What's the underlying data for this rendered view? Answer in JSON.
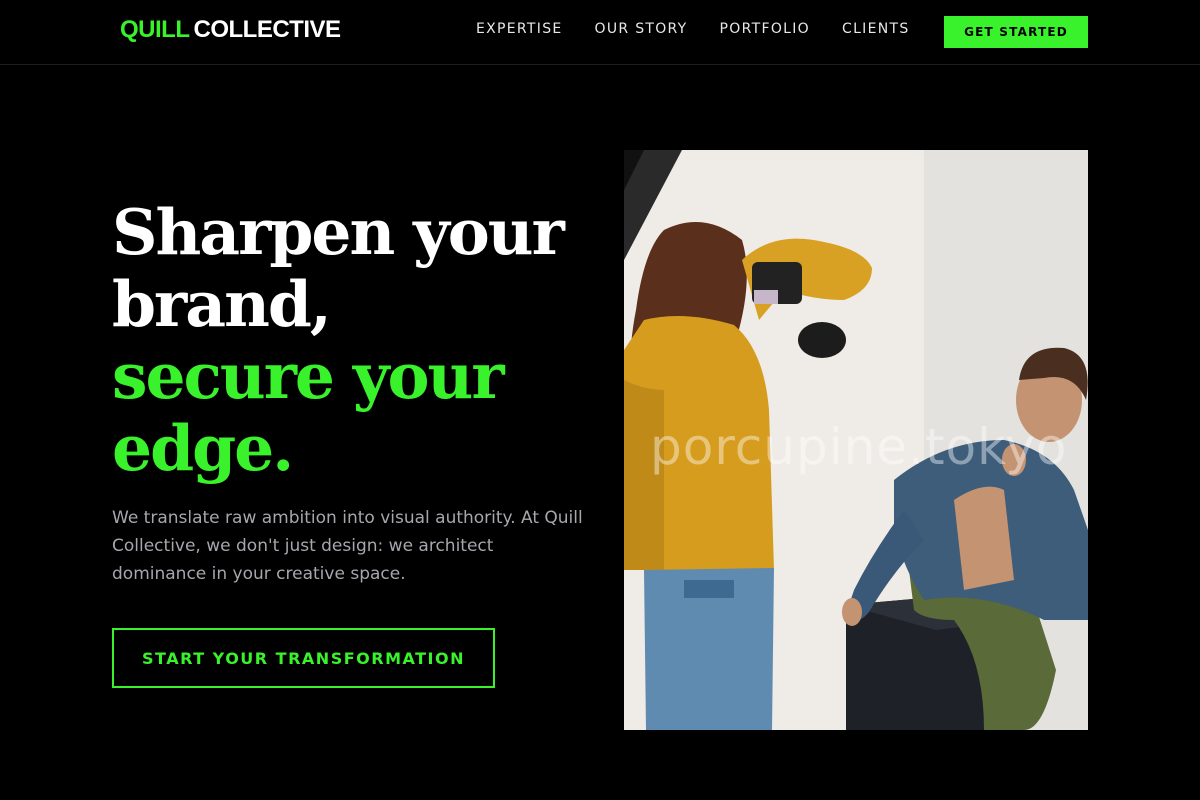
{
  "brand": {
    "accent": "QUILL",
    "rest": "COLLECTIVE"
  },
  "nav": {
    "items": [
      "EXPERTISE",
      "OUR STORY",
      "PORTFOLIO",
      "CLIENTS"
    ],
    "cta": "GET STARTED"
  },
  "hero": {
    "headline": {
      "line1": "Sharpen your",
      "line2": "brand,",
      "line3": "secure your",
      "line4": "edge."
    },
    "body": "We translate raw ambition into visual authority. At Quill Collective, we don't just design: we architect dominance in your creative space.",
    "cta": "START YOUR TRANSFORMATION"
  },
  "photo": {
    "watermark": "porcupine.tokyo"
  },
  "colors": {
    "accent": "#39f22b",
    "background": "#000000",
    "body_text": "#a6a6ad"
  }
}
